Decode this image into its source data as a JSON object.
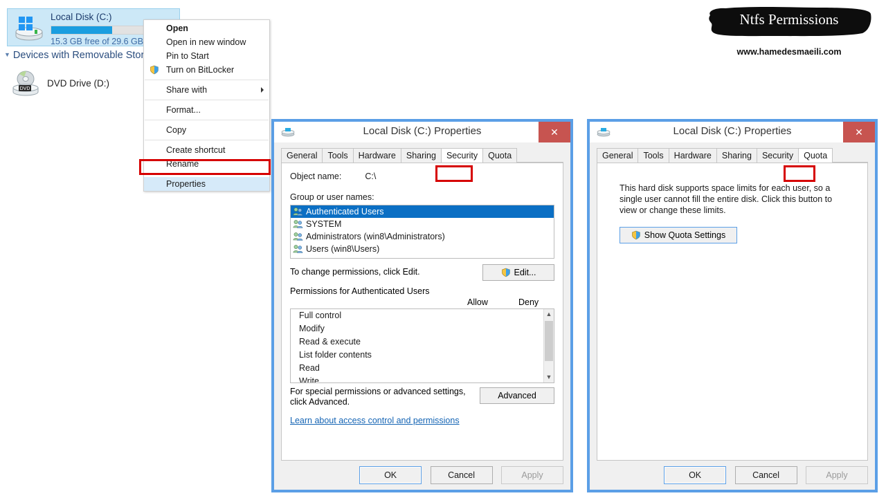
{
  "explorer": {
    "drive": {
      "name": "Local Disk (C:)",
      "free_text": "15.3 GB free of 29.6 GB",
      "used_percent": 48,
      "bar_color": "#1a9ee0"
    },
    "section_header": "Devices with Removable Stora",
    "dvd": {
      "name": "DVD Drive (D:)"
    }
  },
  "context_menu": {
    "items": [
      {
        "label": "Open",
        "bold": true,
        "icon": null,
        "submenu": false
      },
      {
        "label": "Open in new window",
        "bold": false,
        "icon": null,
        "submenu": false
      },
      {
        "label": "Pin to Start",
        "bold": false,
        "icon": null,
        "submenu": false
      },
      {
        "label": "Turn on BitLocker",
        "bold": false,
        "icon": "shield-icon",
        "submenu": false
      },
      {
        "label": "Share with",
        "bold": false,
        "icon": null,
        "submenu": true
      },
      {
        "label": "Format...",
        "bold": false,
        "icon": null,
        "submenu": false
      },
      {
        "label": "Copy",
        "bold": false,
        "icon": null,
        "submenu": false
      },
      {
        "label": "Create shortcut",
        "bold": false,
        "icon": null,
        "submenu": false
      },
      {
        "label": "Rename",
        "bold": false,
        "icon": null,
        "submenu": false
      },
      {
        "label": "Properties",
        "bold": false,
        "icon": null,
        "submenu": false
      }
    ],
    "highlighted_item": "Properties",
    "highlight_color": "#d60000"
  },
  "security_dialog": {
    "title": "Local Disk (C:) Properties",
    "close_label": "✕",
    "tabs": [
      {
        "label": "General",
        "active": false
      },
      {
        "label": "Tools",
        "active": false
      },
      {
        "label": "Hardware",
        "active": false
      },
      {
        "label": "Sharing",
        "active": false
      },
      {
        "label": "Security",
        "active": true
      },
      {
        "label": "Quota",
        "active": false
      }
    ],
    "object_name_label": "Object name:",
    "object_name_value": "C:\\",
    "group_label": "Group or user names:",
    "groups": [
      {
        "name": "Authenticated Users",
        "selected": true
      },
      {
        "name": "SYSTEM",
        "selected": false
      },
      {
        "name": "Administrators (win8\\Administrators)",
        "selected": false
      },
      {
        "name": "Users (win8\\Users)",
        "selected": false
      }
    ],
    "edit_hint": "To change permissions, click Edit.",
    "edit_button": "Edit...",
    "permissions_header": "Permissions for Authenticated Users",
    "allow_column": "Allow",
    "deny_column": "Deny",
    "permissions": [
      "Full control",
      "Modify",
      "Read & execute",
      "List folder contents",
      "Read",
      "Write"
    ],
    "advanced_hint": "For special permissions or advanced settings, click Advanced.",
    "advanced_button": "Advanced",
    "link_text": "Learn about access control and permissions",
    "buttons": {
      "ok": "OK",
      "cancel": "Cancel",
      "apply": "Apply",
      "apply_disabled": true
    }
  },
  "quota_dialog": {
    "title": "Local Disk (C:) Properties",
    "close_label": "✕",
    "tabs": [
      {
        "label": "General",
        "active": false
      },
      {
        "label": "Tools",
        "active": false
      },
      {
        "label": "Hardware",
        "active": false
      },
      {
        "label": "Sharing",
        "active": false
      },
      {
        "label": "Security",
        "active": false
      },
      {
        "label": "Quota",
        "active": true
      }
    ],
    "body_text": "This hard disk supports space limits for each user, so a single user cannot fill the entire disk. Click this button to view or change these limits.",
    "quota_button": "Show Quota Settings",
    "buttons": {
      "ok": "OK",
      "cancel": "Cancel",
      "apply": "Apply",
      "apply_disabled": true
    }
  },
  "watermark": {
    "title": "Ntfs Permissions",
    "url": "www.hamedesmaeili.com"
  },
  "colors": {
    "dialog_border": "#5b9fe6",
    "close_red": "#c75450",
    "selection_blue": "#0b6fc4",
    "annotation_red": "#d60000",
    "link_blue": "#1464b4"
  }
}
